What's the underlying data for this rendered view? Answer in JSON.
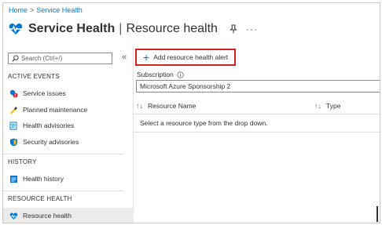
{
  "breadcrumb": {
    "home": "Home",
    "separator": ">",
    "current": "Service Health"
  },
  "header": {
    "title": "Service Health",
    "separator": "|",
    "subtitle": "Resource health",
    "more": "···"
  },
  "sidebar": {
    "search_placeholder": "Search (Ctrl+/)",
    "collapse": "«",
    "sections": {
      "active_events": "ACTIVE EVENTS",
      "history": "HISTORY",
      "resource_health": "RESOURCE HEALTH"
    },
    "items": {
      "service_issues": "Service issues",
      "planned_maintenance": "Planned maintenance",
      "health_advisories": "Health advisories",
      "security_advisories": "Security advisories",
      "health_history": "Health history",
      "resource_health": "Resource health"
    }
  },
  "main": {
    "add_alert_label": "Add resource health alert",
    "subscription_label": "Subscription",
    "subscription_value": "Microsoft Azure Sponsorship 2",
    "columns": {
      "resource_name": "Resource Name",
      "type": "Type"
    },
    "sort_icon": "↑↓",
    "empty_message": "Select a resource type from the drop down."
  },
  "colors": {
    "accent": "#0078d4",
    "highlight_border": "#d31f1f"
  }
}
